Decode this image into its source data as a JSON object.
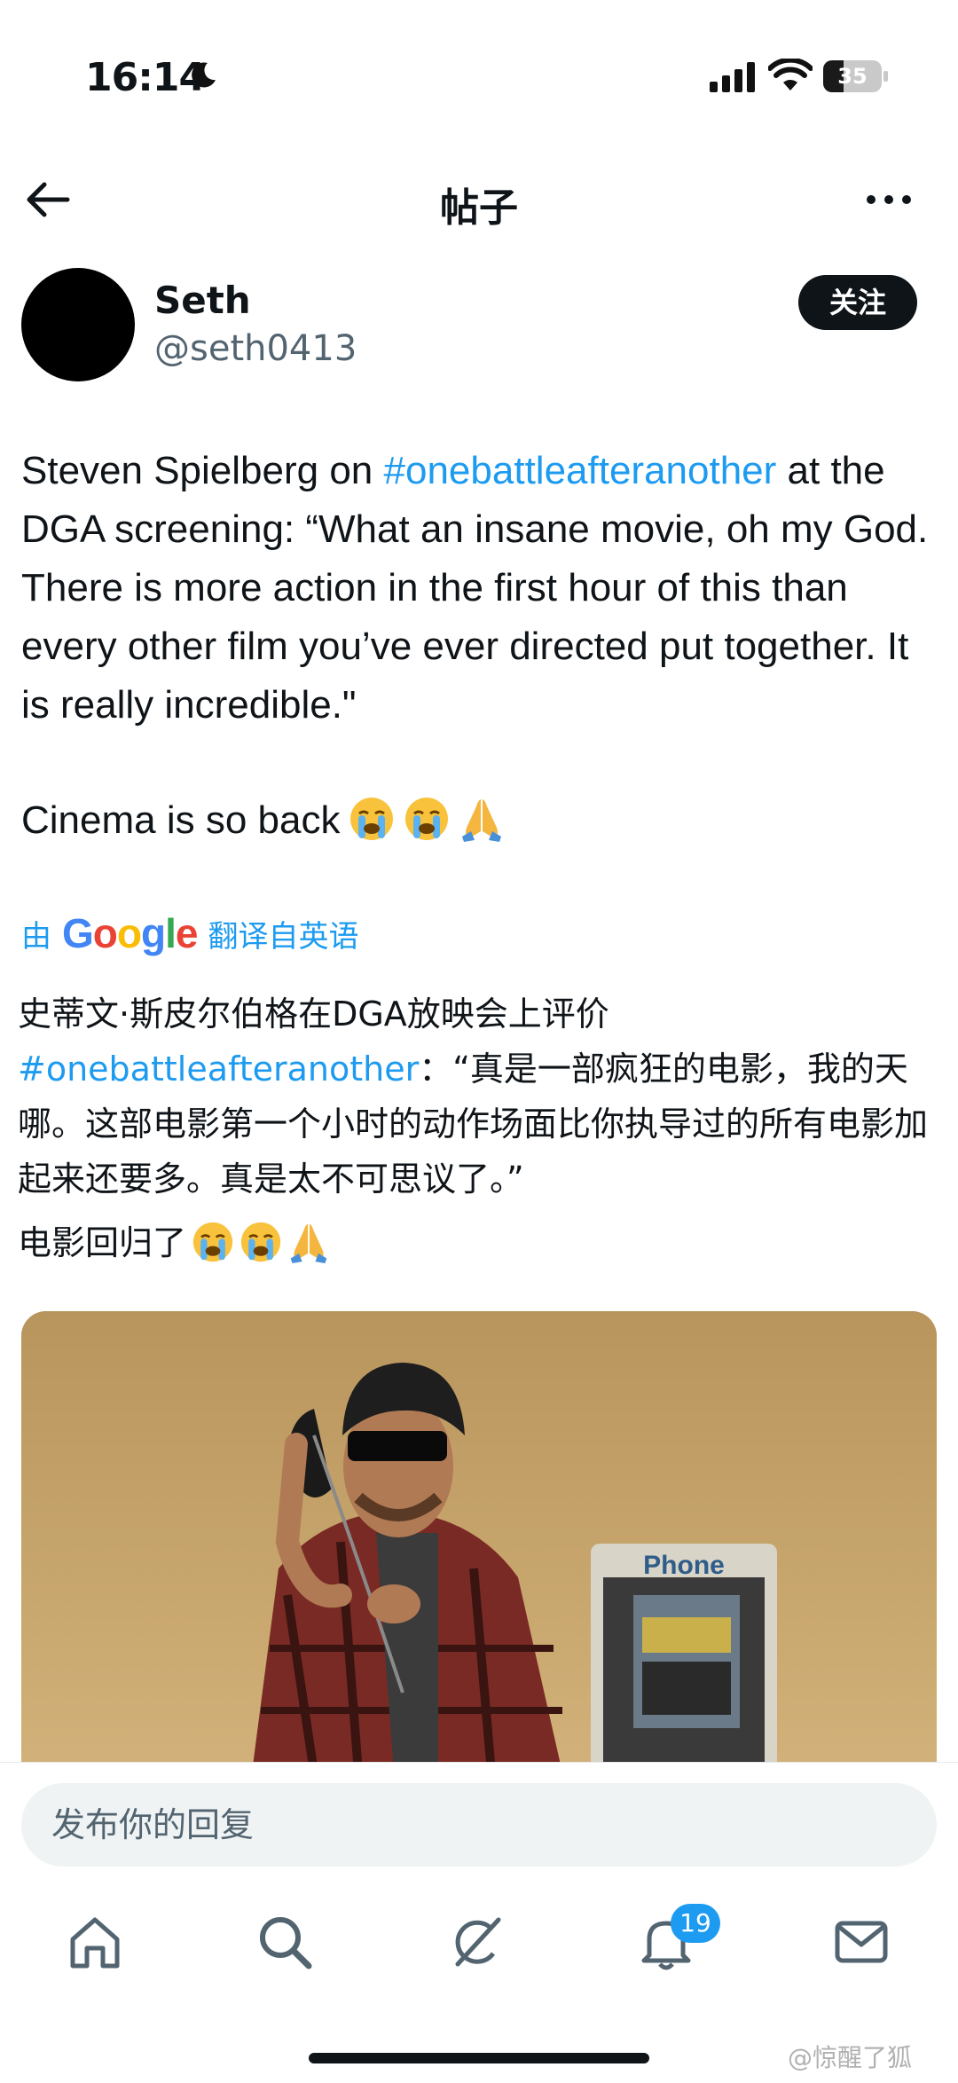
{
  "status_bar": {
    "time": "16:14",
    "battery": "35",
    "battery_level": 0.35,
    "icons": [
      "moon-icon",
      "signal-icon",
      "wifi-icon",
      "battery-icon"
    ]
  },
  "header": {
    "title": "帖子",
    "back_icon": "arrow-left-icon",
    "more_icon": "more-horizontal-icon"
  },
  "author": {
    "name": "Seth",
    "handle": "@seth0413",
    "follow_label": "关注"
  },
  "tweet": {
    "text_before_tag": "Steven Spielberg on ",
    "hashtag": "#onebattleafteranother",
    "text_after_tag": " at the DGA screening: “What an insane movie, oh my God. There is more action in the first hour of this than every other film you’ve ever directed put together. It is really incredible.\"",
    "line2": "Cinema is so back",
    "emojis": [
      "loudly-crying-face",
      "loudly-crying-face",
      "folded-hands"
    ]
  },
  "translation": {
    "prefix": "由",
    "provider": "Google",
    "suffix": "翻译自英语",
    "text_before_tag": "史蒂文·斯皮尔伯格在DGA放映会上评价",
    "hashtag": "#onebattleafteranother",
    "text_after_tag": "：“真是一部疯狂的电影，我的天哪。这部电影第一个小时的动作场面比你执导过的所有电影加起来还要多。真是太不可思议了。”",
    "line2": "电影回归了"
  },
  "media": {
    "sign_text": "Phone"
  },
  "reply": {
    "placeholder": "发布你的回复"
  },
  "nav": {
    "items": [
      "home-icon",
      "search-icon",
      "grok-icon",
      "notifications-icon",
      "messages-icon"
    ],
    "notification_count": "19"
  },
  "watermark": "@惊醒了狐"
}
